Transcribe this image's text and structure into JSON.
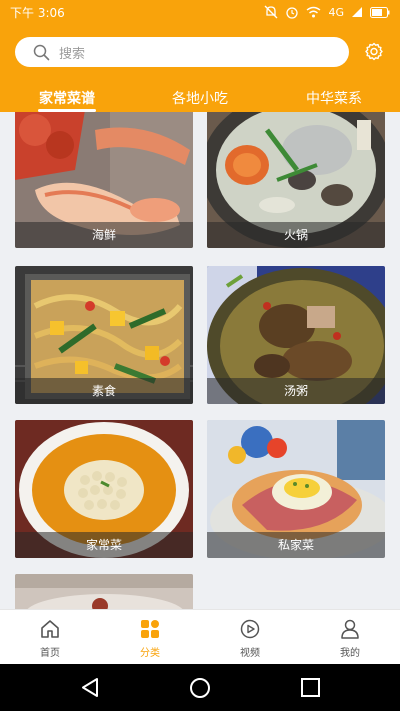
{
  "status_bar": {
    "time": "下午 3:06",
    "network": "4G"
  },
  "search": {
    "placeholder": "搜索"
  },
  "tabs": [
    {
      "label": "家常菜谱",
      "active": true
    },
    {
      "label": "各地小吃",
      "active": false
    },
    {
      "label": "中华菜系",
      "active": false
    }
  ],
  "categories": [
    {
      "label": "海鲜"
    },
    {
      "label": "火锅"
    },
    {
      "label": "素食"
    },
    {
      "label": "汤粥"
    },
    {
      "label": "家常菜"
    },
    {
      "label": "私家菜"
    }
  ],
  "bottom_nav": [
    {
      "label": "首页",
      "icon": "home-icon",
      "active": false
    },
    {
      "label": "分类",
      "icon": "category-icon",
      "active": true
    },
    {
      "label": "视频",
      "icon": "video-icon",
      "active": false
    },
    {
      "label": "我的",
      "icon": "user-icon",
      "active": false
    }
  ],
  "colors": {
    "accent": "#f9a30b",
    "background": "#eef0f3"
  }
}
